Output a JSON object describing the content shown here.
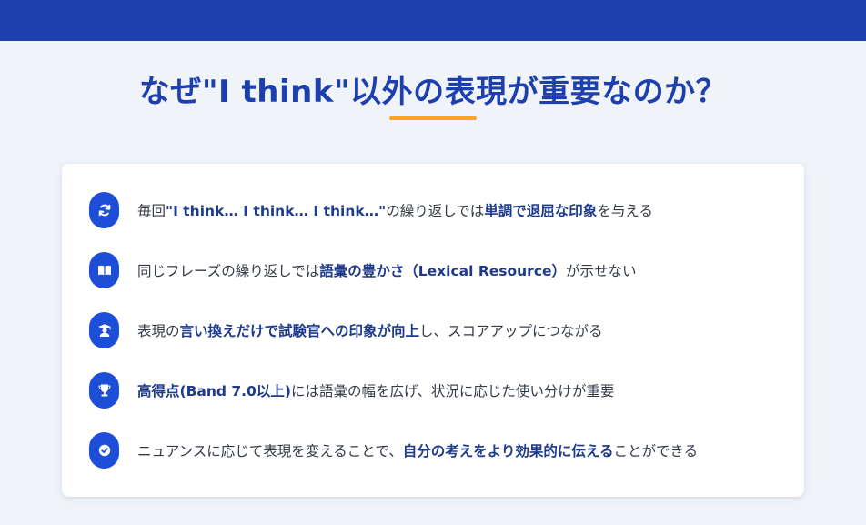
{
  "page": {
    "title": "なぜ\"I think\"以外の表現が重要なのか？"
  },
  "items": [
    {
      "icon": "refresh-icon",
      "p1": "毎回",
      "b1": "\"I think… I think… I think…\"",
      "p2": "の繰り返しでは",
      "b2": "単調で退屈な印象",
      "p3": "を与える"
    },
    {
      "icon": "book-icon",
      "p1": "同じフレーズの繰り返しでは",
      "b1": "語彙の豊かさ（Lexical Resource）",
      "p2": "が示せない",
      "b2": "",
      "p3": ""
    },
    {
      "icon": "graduate-icon",
      "p1": "表現の",
      "b1": "言い換えだけで試験官への印象が向上",
      "p2": "し、スコアアップにつながる",
      "b2": "",
      "p3": ""
    },
    {
      "icon": "trophy-icon",
      "p1": "",
      "b1": "高得点(Band 7.0以上)",
      "p2": "には語彙の幅を広げ、状況に応じた使い分けが重要",
      "b2": "",
      "p3": ""
    },
    {
      "icon": "check-circle-icon",
      "p1": "ニュアンスに応じて表現を変えることで、",
      "b1": "自分の考えをより効果的に伝える",
      "p2": "ことができる",
      "b2": "",
      "p3": ""
    }
  ],
  "colors": {
    "header": "#1e40af",
    "accent": "#f5a623",
    "icon_bg": "#1d4ed8",
    "emphasis": "#1e3a8a",
    "background": "#f0f4f9"
  }
}
